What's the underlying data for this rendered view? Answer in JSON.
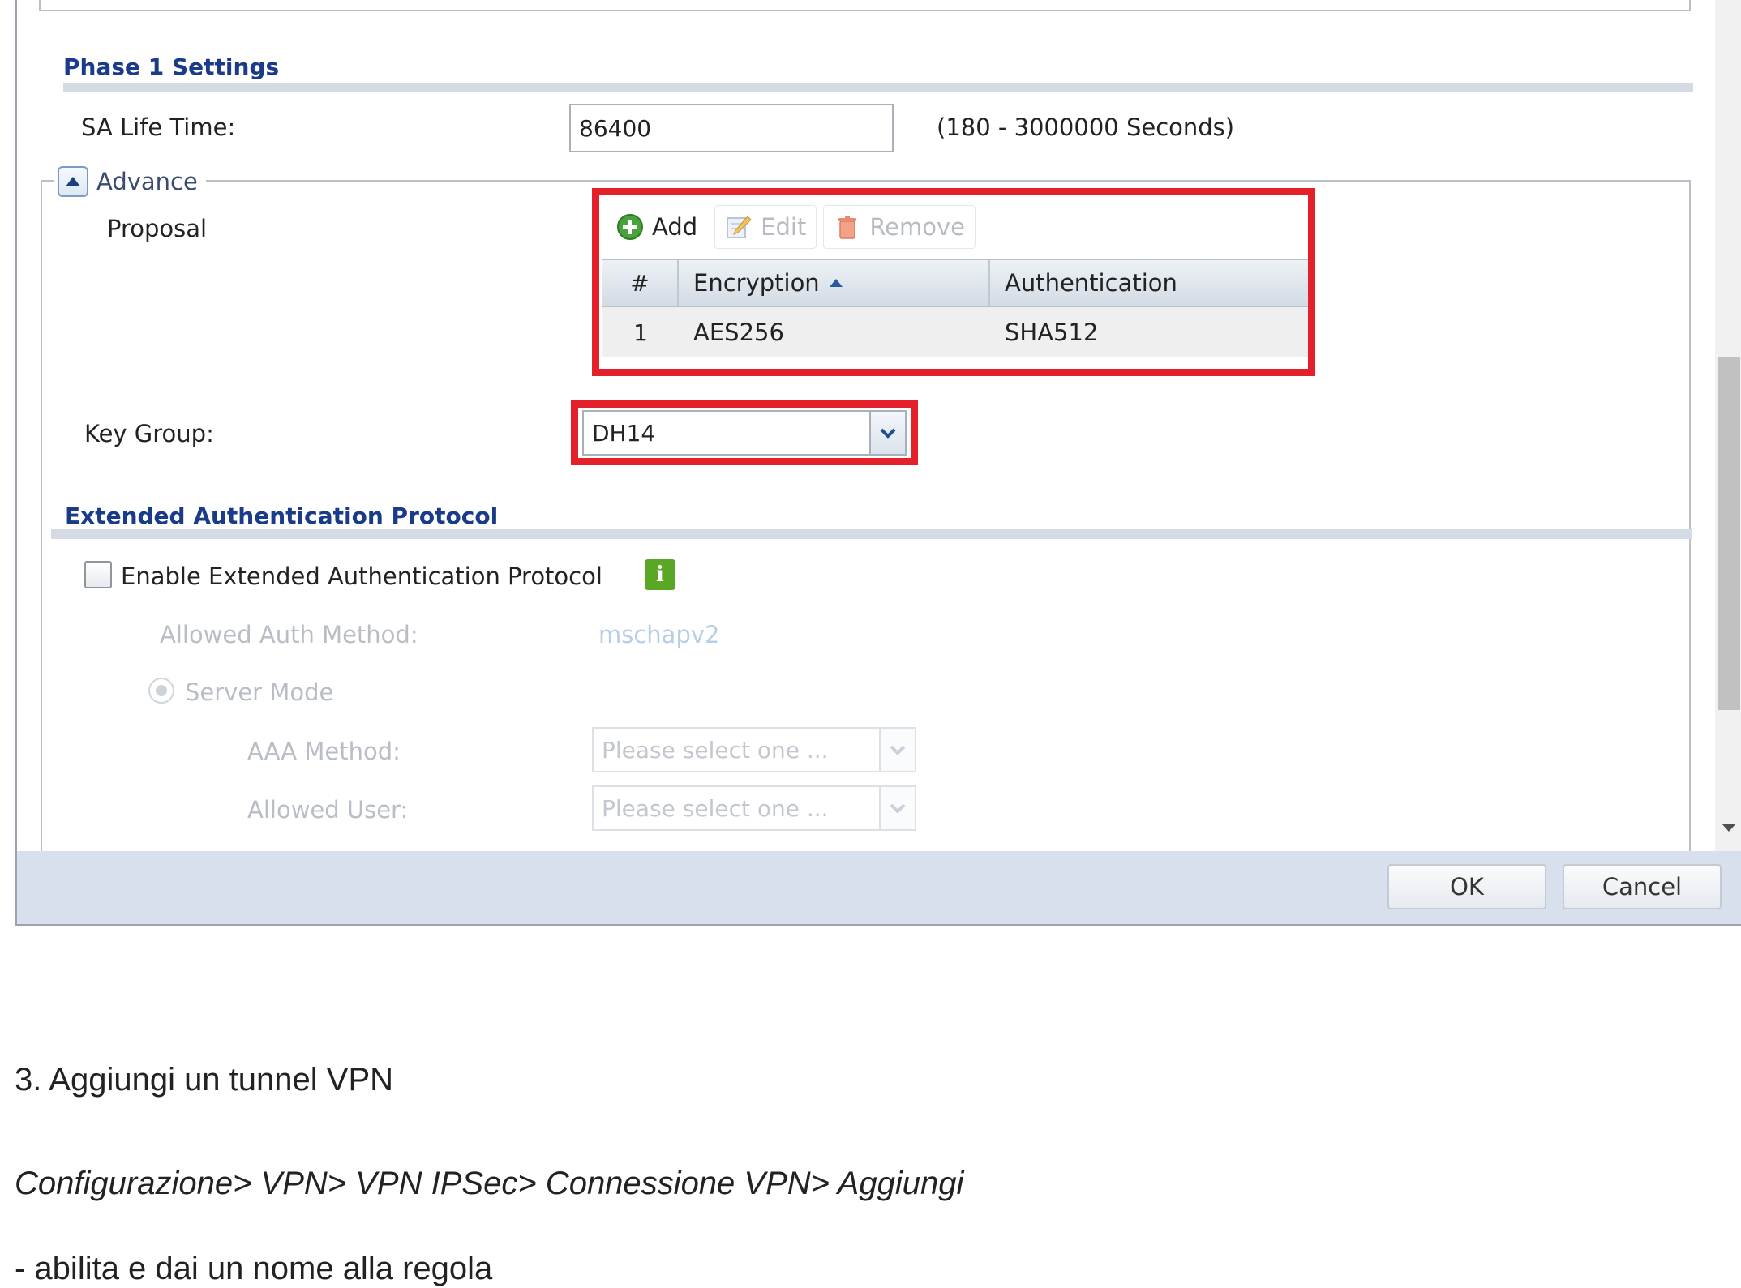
{
  "phase1": {
    "title": "Phase 1 Settings",
    "sa_life_time_label": "SA Life Time:",
    "sa_life_time_value": "86400",
    "sa_life_time_hint": "(180 - 3000000 Seconds)",
    "advance_label": "Advance",
    "proposal_label": "Proposal",
    "toolbar": {
      "add": "Add",
      "edit": "Edit",
      "remove": "Remove"
    },
    "table": {
      "columns": [
        "#",
        "Encryption",
        "Authentication"
      ],
      "rows": [
        {
          "num": "1",
          "encryption": "AES256",
          "authentication": "SHA512"
        }
      ]
    },
    "key_group_label": "Key Group:",
    "key_group_value": "DH14"
  },
  "xauth": {
    "title": "Extended Authentication Protocol",
    "enable_label": "Enable Extended Authentication Protocol",
    "enabled": false,
    "allowed_auth_method_label": "Allowed Auth Method:",
    "allowed_auth_method_value": "mschapv2",
    "server_mode_label": "Server Mode",
    "aaa_method_label": "AAA Method:",
    "aaa_method_placeholder": "Please select one ...",
    "allowed_user_label": "Allowed User:",
    "allowed_user_placeholder": "Please select one ..."
  },
  "footer": {
    "ok": "OK",
    "cancel": "Cancel"
  },
  "colors": {
    "highlight": "#e4202a",
    "section_title": "#1a3a8a",
    "info_icon": "#5aa625"
  },
  "article": {
    "step": "3. Aggiungi un tunnel VPN",
    "path": "Configurazione> VPN> VPN IPSec> Connessione VPN> Aggiungi",
    "bullet": "- abilita e dai un nome alla regola"
  }
}
